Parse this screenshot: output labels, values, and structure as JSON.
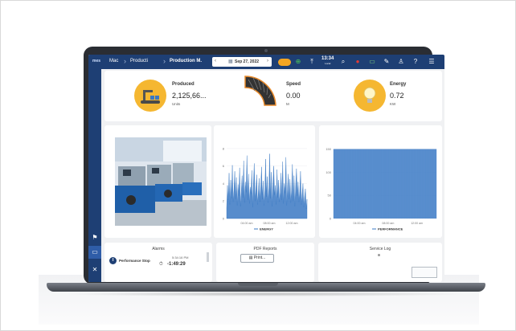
{
  "topbar": {
    "logo": "mes",
    "breadcrumbs": [
      "Mac",
      "Producti",
      "Production M."
    ],
    "date_prev": "‹",
    "date_next": "›",
    "date": "Sep 27, 2022",
    "clock_time": "13:34",
    "clock_sub": "Local"
  },
  "kpis": [
    {
      "name": "Produced",
      "value": "2,125,66...",
      "unit": "Units",
      "color": "#f5b731"
    },
    {
      "name": "Speed",
      "value": "0.00",
      "unit": "M",
      "color": "#e88a2b"
    },
    {
      "name": "Energy",
      "value": "0.72",
      "unit": "KW",
      "color": "#f5b731"
    }
  ],
  "alarms": {
    "title": "Alarms",
    "item_label": "Performance Stop",
    "item_time": "5:34:16 PM",
    "item_duration": "-1:49:29"
  },
  "pdf_reports": {
    "title": "PDF Reports",
    "button": "Print..."
  },
  "service_log": {
    "title": "Service Log"
  },
  "chart_data": [
    {
      "type": "area",
      "title": "",
      "legend": [
        "ENERGY"
      ],
      "x_ticks": [
        "04:00 am",
        "08:00 am",
        "12:00 am"
      ],
      "y_ticks": [
        0,
        2,
        4,
        6,
        8
      ],
      "ylim": [
        0,
        9
      ],
      "series": [
        {
          "name": "ENERGY",
          "color": "#3a78c3",
          "values": [
            1.2,
            3.8,
            2.1,
            5.2,
            1.6,
            4.4,
            2.3,
            6.1,
            1.9,
            3.3,
            5.4,
            2.2,
            4.7,
            1.5,
            3.9,
            2.6,
            5.8,
            1.4,
            3.1,
            4.9,
            2.4,
            6.6,
            1.8,
            4.2,
            3.0,
            7.2,
            2.1,
            5.1,
            1.7,
            3.6,
            2.8,
            5.5,
            1.3,
            4.0,
            6.3,
            2.0,
            3.4,
            5.0,
            1.6,
            2.9,
            4.6,
            1.9,
            3.7,
            5.9,
            2.2,
            4.3,
            1.5,
            3.2,
            6.8,
            2.5,
            4.8,
            1.8,
            3.5,
            7.4,
            2.3,
            5.3,
            1.4,
            4.1,
            6.0,
            2.7,
            3.8,
            1.6,
            5.6,
            2.4,
            4.4,
            1.9,
            3.0,
            5.2,
            2.1,
            6.5,
            1.7,
            4.0,
            2.9,
            7.0,
            1.5,
            3.6,
            5.1,
            2.2,
            4.5,
            1.8,
            3.3,
            6.2,
            2.0,
            4.9,
            1.4,
            3.7,
            5.7,
            2.6,
            4.2,
            1.9,
            3.1,
            5.4,
            1.6,
            2.8,
            4.0,
            1.3,
            2.5,
            3.4,
            1.1,
            2.2
          ]
        }
      ]
    },
    {
      "type": "area",
      "title": "",
      "legend": [
        "PERFORMANCE"
      ],
      "x_ticks": [
        "04:00 am",
        "08:00 am",
        "12:00 am"
      ],
      "y_ticks": [
        0,
        50,
        100,
        150
      ],
      "ylim": [
        0,
        170
      ],
      "series": [
        {
          "name": "PERFORMANCE",
          "color": "#3a78c3",
          "low": 0,
          "high": 150
        }
      ]
    }
  ],
  "sidebar": {
    "items": [
      "flag-icon",
      "laptop-icon",
      "tools-icon"
    ]
  }
}
